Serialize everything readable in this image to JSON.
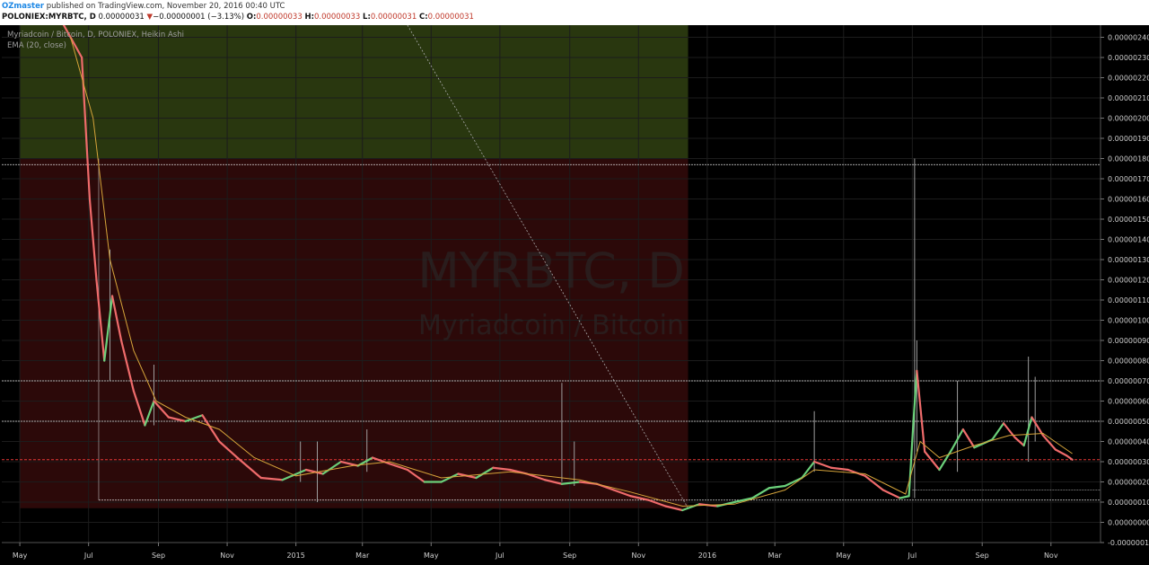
{
  "header": {
    "author": "OZmaster",
    "published": "published on TradingView.com, November 20, 2016 00:40 UTC",
    "symbol": "POLONIEX:MYRBTC, D",
    "price": "0.00000031",
    "change_arrow": "▼",
    "change": "−0.00000001 (−3.13%)",
    "o_label": "O:",
    "o_value": "0.00000033",
    "h_label": "H:",
    "h_value": "0.00000033",
    "l_label": "L:",
    "l_value": "0.00000031",
    "c_label": "C:",
    "c_value": "0.00000031"
  },
  "chart_data": {
    "type": "line",
    "title": "Myriadcoin / Bitcoin, D, POLONIEX, Heikin Ashi",
    "indicator": "EMA (20, close)",
    "watermark_symbol": "MYRBTC, D",
    "watermark_name": "Myriadcoin / Bitcoin",
    "y_unit_scale": "BTC",
    "ylim": [
      -1e-07,
      2.46e-06
    ],
    "y_ticks": [
      "0.00000240",
      "0.00000230",
      "0.00000220",
      "0.00000210",
      "0.00000200",
      "0.00000190",
      "0.00000180",
      "0.00000170",
      "0.00000160",
      "0.00000150",
      "0.00000140",
      "0.00000130",
      "0.00000120",
      "0.00000110",
      "0.00000100",
      "0.00000090",
      "0.00000080",
      "0.00000070",
      "0.00000060",
      "0.00000050",
      "0.00000040",
      "0.00000030",
      "0.00000020",
      "0.00000010",
      "0.00000000",
      "-0.00000010"
    ],
    "x_ticks": [
      {
        "label": "May",
        "date": "2014-05-01"
      },
      {
        "label": "Jul",
        "date": "2014-07-01"
      },
      {
        "label": "Sep",
        "date": "2014-09-01"
      },
      {
        "label": "Nov",
        "date": "2014-11-01"
      },
      {
        "label": "2015",
        "date": "2015-01-01"
      },
      {
        "label": "Mar",
        "date": "2015-03-01"
      },
      {
        "label": "May",
        "date": "2015-05-01"
      },
      {
        "label": "Jul",
        "date": "2015-07-01"
      },
      {
        "label": "Sep",
        "date": "2015-09-01"
      },
      {
        "label": "Nov",
        "date": "2015-11-01"
      },
      {
        "label": "2016",
        "date": "2016-01-01"
      },
      {
        "label": "Mar",
        "date": "2016-03-01"
      },
      {
        "label": "May",
        "date": "2016-05-01"
      },
      {
        "label": "Jul",
        "date": "2016-07-01"
      },
      {
        "label": "Sep",
        "date": "2016-09-01"
      },
      {
        "label": "Nov",
        "date": "2016-11-01"
      }
    ],
    "price_series": [
      [
        "2014-05-15",
        2.6e-06
      ],
      [
        "2014-06-05",
        2.5e-06
      ],
      [
        "2014-06-25",
        2.3e-06
      ],
      [
        "2014-07-02",
        1.6e-06
      ],
      [
        "2014-07-08",
        1.2e-06
      ],
      [
        "2014-07-15",
        8e-07
      ],
      [
        "2014-07-22",
        1.12e-06
      ],
      [
        "2014-07-30",
        9e-07
      ],
      [
        "2014-08-10",
        6.5e-07
      ],
      [
        "2014-08-20",
        4.8e-07
      ],
      [
        "2014-08-28",
        6e-07
      ],
      [
        "2014-09-10",
        5.2e-07
      ],
      [
        "2014-09-25",
        5e-07
      ],
      [
        "2014-10-10",
        5.3e-07
      ],
      [
        "2014-10-25",
        4e-07
      ],
      [
        "2014-11-10",
        3.2e-07
      ],
      [
        "2014-12-01",
        2.2e-07
      ],
      [
        "2014-12-20",
        2.1e-07
      ],
      [
        "2015-01-10",
        2.6e-07
      ],
      [
        "2015-01-25",
        2.4e-07
      ],
      [
        "2015-02-10",
        3e-07
      ],
      [
        "2015-02-25",
        2.8e-07
      ],
      [
        "2015-03-10",
        3.2e-07
      ],
      [
        "2015-03-25",
        2.9e-07
      ],
      [
        "2015-04-10",
        2.6e-07
      ],
      [
        "2015-04-25",
        2e-07
      ],
      [
        "2015-05-10",
        2e-07
      ],
      [
        "2015-05-25",
        2.4e-07
      ],
      [
        "2015-06-10",
        2.2e-07
      ],
      [
        "2015-06-25",
        2.7e-07
      ],
      [
        "2015-07-10",
        2.6e-07
      ],
      [
        "2015-07-25",
        2.4e-07
      ],
      [
        "2015-08-10",
        2.1e-07
      ],
      [
        "2015-08-25",
        1.9e-07
      ],
      [
        "2015-09-10",
        2e-07
      ],
      [
        "2015-09-25",
        1.9e-07
      ],
      [
        "2015-10-10",
        1.6e-07
      ],
      [
        "2015-10-25",
        1.3e-07
      ],
      [
        "2015-11-10",
        1.1e-07
      ],
      [
        "2015-11-25",
        8e-08
      ],
      [
        "2015-12-10",
        6e-08
      ],
      [
        "2015-12-25",
        9e-08
      ],
      [
        "2016-01-10",
        8e-08
      ],
      [
        "2016-01-25",
        1e-07
      ],
      [
        "2016-02-10",
        1.2e-07
      ],
      [
        "2016-02-25",
        1.7e-07
      ],
      [
        "2016-03-10",
        1.8e-07
      ],
      [
        "2016-03-25",
        2.2e-07
      ],
      [
        "2016-04-05",
        3e-07
      ],
      [
        "2016-04-20",
        2.7e-07
      ],
      [
        "2016-05-05",
        2.6e-07
      ],
      [
        "2016-05-20",
        2.3e-07
      ],
      [
        "2016-06-05",
        1.6e-07
      ],
      [
        "2016-06-20",
        1.2e-07
      ],
      [
        "2016-06-28",
        1.3e-07
      ],
      [
        "2016-07-02",
        5e-07
      ],
      [
        "2016-07-05",
        7.5e-07
      ],
      [
        "2016-07-12",
        3.5e-07
      ],
      [
        "2016-07-25",
        2.6e-07
      ],
      [
        "2016-08-05",
        3.6e-07
      ],
      [
        "2016-08-15",
        4.6e-07
      ],
      [
        "2016-08-25",
        3.7e-07
      ],
      [
        "2016-09-10",
        4.1e-07
      ],
      [
        "2016-09-20",
        4.9e-07
      ],
      [
        "2016-09-30",
        4.2e-07
      ],
      [
        "2016-10-08",
        3.8e-07
      ],
      [
        "2016-10-15",
        5.2e-07
      ],
      [
        "2016-10-25",
        4.3e-07
      ],
      [
        "2016-11-05",
        3.6e-07
      ],
      [
        "2016-11-15",
        3.3e-07
      ],
      [
        "2016-11-20",
        3.1e-07
      ]
    ],
    "spikes": [
      [
        "2014-07-20",
        1.35e-06,
        7e-07
      ],
      [
        "2014-08-28",
        7.8e-07,
        4.8e-07
      ],
      [
        "2015-01-05",
        4e-07,
        2e-07
      ],
      [
        "2015-01-20",
        4e-07,
        1e-07
      ],
      [
        "2015-03-05",
        4.6e-07,
        2.5e-07
      ],
      [
        "2015-08-25",
        6.9e-07,
        2e-07
      ],
      [
        "2015-09-05",
        4e-07,
        1.8e-07
      ],
      [
        "2016-04-05",
        5.5e-07,
        2.5e-07
      ],
      [
        "2016-07-03",
        1.8e-06,
        1.2e-07
      ],
      [
        "2016-07-05",
        9e-07,
        3.5e-07
      ],
      [
        "2016-08-10",
        7e-07,
        2.5e-07
      ],
      [
        "2016-10-12",
        8.2e-07,
        3e-07
      ],
      [
        "2016-10-18",
        7.2e-07,
        4e-07
      ]
    ],
    "ema_series": [
      [
        "2014-06-15",
        2.4e-06
      ],
      [
        "2014-07-05",
        2e-06
      ],
      [
        "2014-07-20",
        1.3e-06
      ],
      [
        "2014-08-10",
        8.5e-07
      ],
      [
        "2014-08-30",
        6e-07
      ],
      [
        "2014-09-25",
        5.2e-07
      ],
      [
        "2014-10-25",
        4.6e-07
      ],
      [
        "2014-11-25",
        3.2e-07
      ],
      [
        "2015-01-01",
        2.3e-07
      ],
      [
        "2015-02-20",
        2.8e-07
      ],
      [
        "2015-03-25",
        3e-07
      ],
      [
        "2015-05-10",
        2.2e-07
      ],
      [
        "2015-07-10",
        2.5e-07
      ],
      [
        "2015-09-10",
        2.1e-07
      ],
      [
        "2015-10-25",
        1.5e-07
      ],
      [
        "2015-12-10",
        8e-08
      ],
      [
        "2016-01-25",
        9e-08
      ],
      [
        "2016-03-10",
        1.6e-07
      ],
      [
        "2016-04-05",
        2.6e-07
      ],
      [
        "2016-05-20",
        2.4e-07
      ],
      [
        "2016-06-25",
        1.4e-07
      ],
      [
        "2016-07-08",
        4e-07
      ],
      [
        "2016-07-25",
        3.2e-07
      ],
      [
        "2016-08-25",
        3.8e-07
      ],
      [
        "2016-09-25",
        4.3e-07
      ],
      [
        "2016-10-25",
        4.4e-07
      ],
      [
        "2016-11-20",
        3.4e-07
      ]
    ],
    "horizontal_levels": [
      {
        "value": 1.77e-06,
        "label": "0.00000177"
      },
      {
        "value": 7e-07,
        "label": "0.00000070"
      },
      {
        "value": 5e-07,
        "label": "0.00000050"
      },
      {
        "value": 1.1e-07,
        "label": "0.00000011"
      }
    ],
    "current_price_label": "0.00000031",
    "current_price_value": 3.1e-07,
    "highlight_label": "0.00000016",
    "highlight_value": 1.6e-07,
    "zones": {
      "green": {
        "x_from": "2014-05-01",
        "x_to": "2015-12-15",
        "y_from": 2.46e-06,
        "y_to": 1.8e-06
      },
      "red": {
        "x_from": "2014-05-01",
        "x_to": "2015-12-15",
        "y_from": 1.8e-06,
        "y_to": 7e-08
      }
    },
    "diagonal": {
      "from": [
        "2015-04-10",
        2.46e-06
      ],
      "to": [
        "2015-12-15",
        7e-08
      ]
    },
    "grid": true,
    "colors": {
      "up": "#6bd07a",
      "down": "#ef6b6b",
      "ema": "#d6a43a",
      "background": "#000000",
      "highlight": "#ffff00"
    }
  }
}
